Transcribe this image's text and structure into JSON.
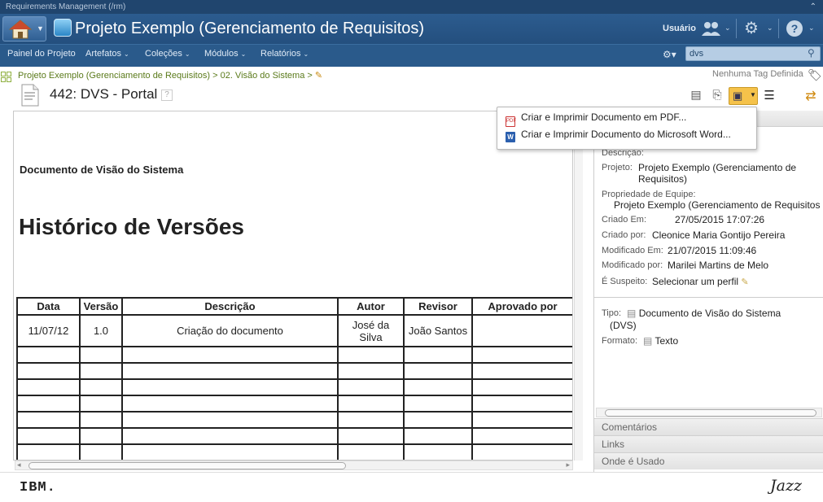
{
  "app": {
    "name": "Requirements Management (/rm)"
  },
  "header": {
    "project_title": "Projeto Exemplo (Gerenciamento de Requisitos)",
    "user_label": "Usuário"
  },
  "nav": {
    "items": [
      {
        "label": "Painel do Projeto",
        "has_menu": false
      },
      {
        "label": "Artefatos",
        "has_menu": true
      },
      {
        "label": "Coleções",
        "has_menu": true
      },
      {
        "label": "Módulos",
        "has_menu": true
      },
      {
        "label": "Relatórios",
        "has_menu": true
      }
    ],
    "search_value": "dvs"
  },
  "breadcrumb": {
    "parts": [
      "Projeto Exemplo (Gerenciamento de Requisitos)",
      "02. Visão do Sistema"
    ],
    "separator": ">"
  },
  "tags": {
    "label": "Nenhuma Tag Definida"
  },
  "artifact": {
    "id": "442:",
    "title": "DVS - Portal",
    "help": "?"
  },
  "document": {
    "heading": "Documento de Visão do Sistema",
    "history_title": "Histórico de Versões",
    "table": {
      "headers": [
        "Data",
        "Versão",
        "Descrição",
        "Autor",
        "Revisor",
        "Aprovado por"
      ],
      "rows": [
        [
          "11/07/12",
          "1.0",
          "Criação do documento",
          "José da Silva",
          "João Santos",
          ""
        ],
        [
          "",
          "",
          "",
          "",
          "",
          ""
        ],
        [
          "",
          "",
          "",
          "",
          "",
          ""
        ],
        [
          "",
          "",
          "",
          "",
          "",
          ""
        ],
        [
          "",
          "",
          "",
          "",
          "",
          ""
        ],
        [
          "",
          "",
          "",
          "",
          "",
          ""
        ],
        [
          "",
          "",
          "",
          "",
          "",
          ""
        ],
        [
          "",
          "",
          "",
          "",
          "",
          ""
        ]
      ]
    }
  },
  "dropdown": {
    "items": [
      {
        "label": "Criar e Imprimir Documento em PDF...",
        "icon": "pdf-icon"
      },
      {
        "label": "Criar e Imprimir Documento do Microsoft Word...",
        "icon": "word-icon"
      }
    ]
  },
  "properties": {
    "descricao_label": "Descrição:",
    "projeto_label": "Projeto:",
    "projeto_value": "Projeto Exemplo (Gerenciamento de Requisitos)",
    "propriedade_label": "Propriedade de Equipe:",
    "propriedade_value": "Projeto Exemplo (Gerenciamento de Requisitos",
    "criado_em_label": "Criado Em:",
    "criado_em_value": "27/05/2015 17:07:26",
    "criado_por_label": "Criado por:",
    "criado_por_value": "Cleonice Maria Gontijo Pereira",
    "modificado_em_label": "Modificado Em:",
    "modificado_em_value": "21/07/2015 11:09:46",
    "modificado_por_label": "Modificado por:",
    "modificado_por_value": "Marilei Martins de Melo",
    "suspeito_label": "É Suspeito:",
    "suspeito_value": "Selecionar um perfil",
    "tipo_label": "Tipo:",
    "tipo_value": "Documento de Visão do Sistema",
    "tipo_value2": "(DVS)",
    "formato_label": "Formato:",
    "formato_value": "Texto"
  },
  "sections": [
    "Comentários",
    "Links",
    "Onde é Usado"
  ],
  "footer": {
    "ibm": "IBM.",
    "jazz": "Jazz"
  },
  "colors": {
    "header": "#2c5c8f",
    "breadcrumb": "#5a7a1a",
    "highlight_button": "#f5c24a"
  }
}
